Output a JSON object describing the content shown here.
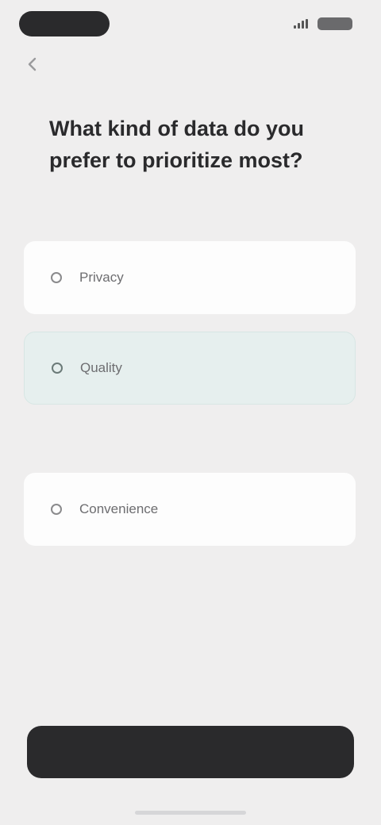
{
  "status_bar": {
    "time": ""
  },
  "nav": {
    "label": ""
  },
  "question": {
    "text": "What kind of data do you prefer to prioritize most?"
  },
  "options": [
    {
      "label": "Privacy",
      "selected": false
    },
    {
      "label": "Quality",
      "selected": true,
      "note": ""
    },
    {
      "label": "Convenience",
      "selected": false
    }
  ],
  "cta": {
    "label": ""
  },
  "colors": {
    "background": "#efeeee",
    "selected_fill": "#e6efee",
    "button": "#2a2a2c"
  }
}
